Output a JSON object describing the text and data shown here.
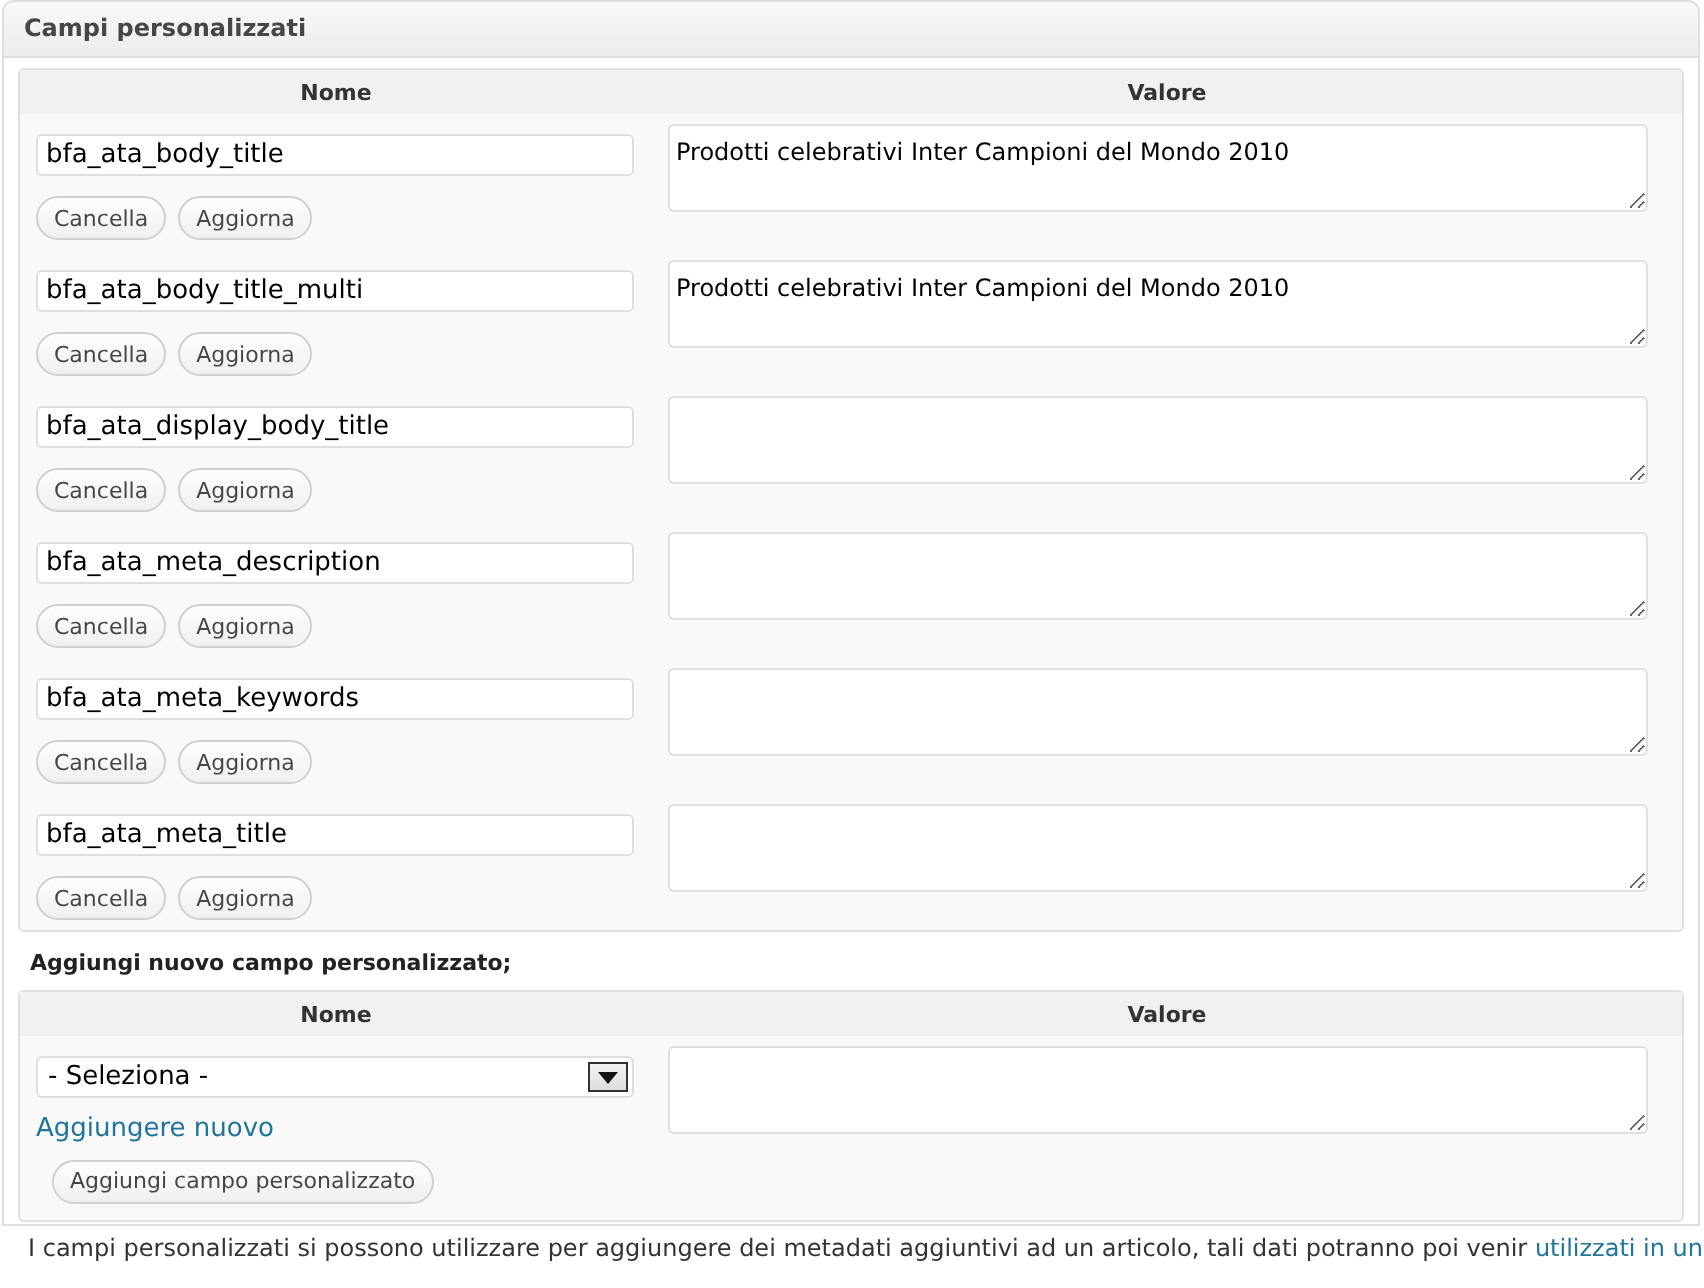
{
  "panel": {
    "title": "Campi personalizzati"
  },
  "table": {
    "columns": [
      "Nome",
      "Valore"
    ],
    "rows": [
      {
        "name": "bfa_ata_body_title",
        "value": "Prodotti celebrativi Inter Campioni del Mondo 2010",
        "buttons": [
          "Cancella",
          "Aggiorna"
        ]
      },
      {
        "name": "bfa_ata_body_title_multi",
        "value": "Prodotti celebrativi Inter Campioni del Mondo 2010",
        "buttons": [
          "Cancella",
          "Aggiorna"
        ]
      },
      {
        "name": "bfa_ata_display_body_title",
        "buttons": [
          "Cancella",
          "Aggiorna"
        ]
      },
      {
        "name": "bfa_ata_meta_description",
        "buttons": [
          "Cancella",
          "Aggiorna"
        ]
      },
      {
        "name": "bfa_ata_meta_keywords",
        "buttons": [
          "Cancella",
          "Aggiorna"
        ]
      },
      {
        "name": "bfa_ata_meta_title",
        "buttons": [
          "Cancella",
          "Aggiorna"
        ]
      }
    ]
  },
  "add_section": {
    "title": "Aggiungi nuovo campo personalizzato;",
    "columns": [
      "Nome",
      "Valore"
    ],
    "select": {
      "value": "- Seleziona -"
    },
    "link": "Aggiungere nuovo",
    "button": "Aggiungi campo personalizzato"
  },
  "note": {
    "text": "I campi personalizzati si possono utilizzare per aggiungere dei metadati aggiuntivi ad un articolo, tali dati potranno poi venir ",
    "link": "utilizzati in un"
  }
}
